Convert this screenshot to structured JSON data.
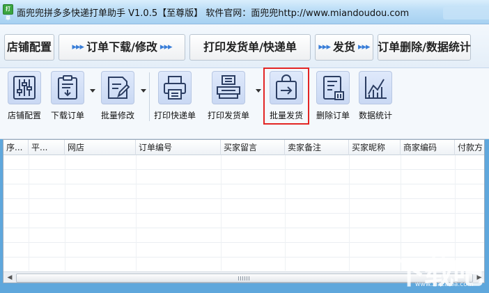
{
  "window": {
    "logo_text": "打单",
    "title": "面兜兜拼多多快递打单助手 V1.0.5【至尊版】  软件官网：面兜兜http://www.miandoudou.com"
  },
  "workflow": {
    "steps": [
      {
        "label": "店铺配置"
      },
      {
        "label": "订单下载/修改"
      },
      {
        "label": "打印发货单/快递单"
      },
      {
        "label": "发货"
      },
      {
        "label": "订单删除/数据统计"
      }
    ],
    "arrow": "▸▸▸"
  },
  "toolbar": {
    "items": [
      {
        "label": "店铺配置",
        "icon": "sliders-icon"
      },
      {
        "label": "下载订单",
        "icon": "clipboard-download-icon"
      },
      {
        "label": "批量修改",
        "icon": "document-edit-icon"
      },
      {
        "label": "打印快递单",
        "icon": "printer-icon"
      },
      {
        "label": "打印发货单",
        "icon": "printer-tray-icon"
      },
      {
        "label": "批量发货",
        "icon": "shopping-bag-arrow-icon"
      },
      {
        "label": "删除订单",
        "icon": "document-delete-icon"
      },
      {
        "label": "数据统计",
        "icon": "line-chart-icon"
      }
    ],
    "highlighted": "批量发货"
  },
  "table": {
    "columns": [
      "序...",
      "平...",
      "网店",
      "订单编号",
      "买家留言",
      "卖家备注",
      "买家昵称",
      "商家编码",
      "付款方"
    ],
    "rows": []
  },
  "watermark": {
    "text": "下载吧",
    "url": "www.xiazaiba.com"
  },
  "colors": {
    "frame": "#5fa7dc",
    "accent": "#3a7ed8",
    "highlight_border": "#e32424"
  }
}
